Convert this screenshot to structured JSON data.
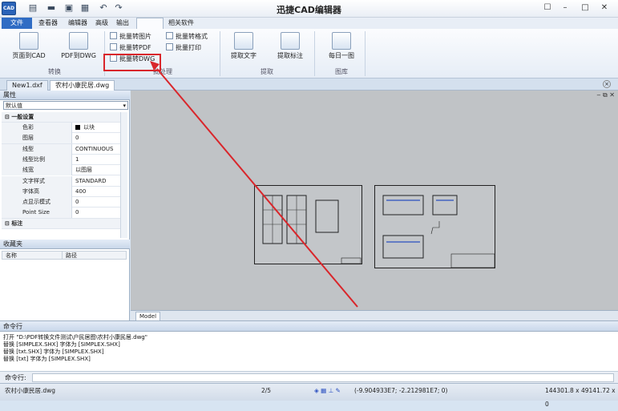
{
  "app": {
    "logo_text": "CAD",
    "title": "迅捷CAD编辑器"
  },
  "quick_access": [
    "new-file-icon",
    "open-folder-icon",
    "save-icon",
    "print-icon",
    "undo-icon",
    "redo-icon"
  ],
  "window_controls": [
    "help-icon",
    "minimize-icon",
    "maximize-icon",
    "close-icon"
  ],
  "menu_tabs": {
    "file": "文件",
    "viewer": "查看器",
    "editor": "编辑器",
    "advanced": "高级",
    "output": "输出",
    "batch": "",
    "related": "相关软件"
  },
  "ribbon": {
    "convert": {
      "page_to_cad": "页面到CAD",
      "pdf_to_dwg": "PDF到DWG",
      "group": "转换"
    },
    "batch": {
      "to_image": "批量转图片",
      "to_pdf": "批量转PDF",
      "to_dwg": "批量转DWG",
      "to_format": "批量转格式",
      "print": "批量打印",
      "group": "批处理"
    },
    "extract": {
      "text": "提取文字",
      "dim": "提取标注",
      "group": "提取"
    },
    "gallery": {
      "daily": "每日一图",
      "group": "图库"
    }
  },
  "doc_tabs": [
    "New1.dxf",
    "农村小康民居.dwg"
  ],
  "properties": {
    "title": "属性",
    "selected": "默认值",
    "section_general": "一般设置",
    "rows": [
      {
        "name": "色彩",
        "value": "以块"
      },
      {
        "name": "图层",
        "value": "0"
      },
      {
        "name": "线型",
        "value": "CONTINUOUS"
      },
      {
        "name": "线型比例",
        "value": "1"
      },
      {
        "name": "线宽",
        "value": "以图层"
      },
      {
        "name": "文字样式",
        "value": "STANDARD"
      },
      {
        "name": "字体高",
        "value": "400"
      },
      {
        "name": "点显示模式",
        "value": "0"
      },
      {
        "name": "Point Size",
        "value": "0"
      }
    ],
    "section_dim": "标注"
  },
  "favorites": {
    "title": "收藏夹",
    "col_name": "名称",
    "col_path": "路径"
  },
  "model_tab": "Model",
  "command": {
    "title": "命令行",
    "lines": [
      "打开 \"D:\\PDF转换文件测试\\户民居图\\农村小康民居.dwg\"",
      "替换 [SIMPLEX.SHX] 字体为 [SIMPLEX.SHX]",
      "替换 [txt.SHX] 字体为 [SIMPLEX.SHX]",
      "替换 [txt] 字体为 [SIMPLEX.SHX]"
    ],
    "prompt": "命令行:"
  },
  "status": {
    "file": "农村小康民居.dwg",
    "page": "2/5",
    "coords": "(-9.904933E7; -2.212981E7; 0)",
    "size": "144301.8 x 49141.72 x 0"
  },
  "colors": {
    "accent": "#2f6cc4",
    "highlight": "#d9262b",
    "arrow": "#d9262b"
  }
}
